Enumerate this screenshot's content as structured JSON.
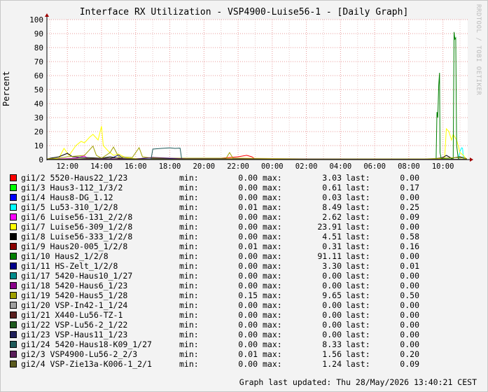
{
  "side_text": "RRDTOOL / TOBI OETIKER",
  "chart_data": {
    "type": "line",
    "title": "Interface RX Utilization - VSP4900-Luise56-1 - [Daily Graph]",
    "ylabel": "Percent",
    "ylim": [
      0,
      100
    ],
    "yticks": [
      0,
      10,
      20,
      30,
      40,
      50,
      60,
      70,
      80,
      90,
      100
    ],
    "xlim_hours": [
      10.8,
      35.45
    ],
    "xticks": [
      {
        "label": "12:00",
        "hour": 12
      },
      {
        "label": "14:00",
        "hour": 14
      },
      {
        "label": "16:00",
        "hour": 16
      },
      {
        "label": "18:00",
        "hour": 18
      },
      {
        "label": "20:00",
        "hour": 20
      },
      {
        "label": "22:00",
        "hour": 22
      },
      {
        "label": "00:00",
        "hour": 24
      },
      {
        "label": "02:00",
        "hour": 26
      },
      {
        "label": "04:00",
        "hour": 28
      },
      {
        "label": "06:00",
        "hour": 30
      },
      {
        "label": "08:00",
        "hour": 32
      },
      {
        "label": "10:00",
        "hour": 34
      },
      {
        "label": "12:00",
        "hour": 36
      }
    ],
    "grid": true,
    "series": [
      {
        "name": "gi1/2 5520-Haus22_1/23",
        "color": "#ff0000",
        "min": "0.00",
        "max": "3.03",
        "last": "0.00",
        "points": [
          [
            10.8,
            0.5
          ],
          [
            14.0,
            0.5
          ],
          [
            18.0,
            0.5
          ],
          [
            19.5,
            0.5
          ],
          [
            21.0,
            1.0
          ],
          [
            21.5,
            1.5
          ],
          [
            22.0,
            2.0
          ],
          [
            22.5,
            3.03
          ],
          [
            22.8,
            2.0
          ],
          [
            23.0,
            0.5
          ],
          [
            24.0,
            0.3
          ],
          [
            30.0,
            0.2
          ],
          [
            35.4,
            0.1
          ]
        ]
      },
      {
        "name": "gi1/3 Haus3-112_1/3/2",
        "color": "#00ff00",
        "min": "0.00",
        "max": "0.61",
        "last": "0.17",
        "points": [
          [
            10.8,
            0.2
          ],
          [
            20.0,
            0.3
          ],
          [
            22.0,
            0.6
          ],
          [
            24.0,
            0.2
          ],
          [
            35.4,
            0.2
          ]
        ]
      },
      {
        "name": "gi1/4 Haus8-DG_1.12",
        "color": "#0000ff",
        "min": "0.00",
        "max": "0.03",
        "last": "0.00",
        "points": [
          [
            10.8,
            0.0
          ],
          [
            35.4,
            0.0
          ]
        ]
      },
      {
        "name": "gi1/5 Lu53-310_1/2/8",
        "color": "#00ffff",
        "min": "0.01",
        "max": "8.49",
        "last": "0.25",
        "points": [
          [
            10.8,
            0.1
          ],
          [
            34.9,
            0.2
          ],
          [
            35.0,
            6.0
          ],
          [
            35.1,
            8.49
          ],
          [
            35.15,
            8.0
          ],
          [
            35.2,
            0.3
          ],
          [
            35.4,
            0.25
          ]
        ]
      },
      {
        "name": "gi1/6 Luise56-131_2/2/8",
        "color": "#ff00ff",
        "min": "0.00",
        "max": "2.62",
        "last": "0.09",
        "points": [
          [
            10.8,
            0.1
          ],
          [
            12.5,
            1.0
          ],
          [
            13.0,
            2.62
          ],
          [
            13.2,
            0.5
          ],
          [
            35.4,
            0.09
          ]
        ]
      },
      {
        "name": "gi1/7 Luise56-309_1/2/8",
        "color": "#ffff00",
        "min": "0.00",
        "max": "23.91",
        "last": "0.00",
        "points": [
          [
            10.8,
            0.0
          ],
          [
            11.5,
            1.0
          ],
          [
            11.8,
            8.0
          ],
          [
            12.1,
            3.0
          ],
          [
            12.5,
            10.0
          ],
          [
            12.8,
            13.0
          ],
          [
            13.0,
            12.0
          ],
          [
            13.3,
            16.0
          ],
          [
            13.5,
            18.0
          ],
          [
            13.8,
            14.0
          ],
          [
            14.0,
            23.91
          ],
          [
            14.1,
            10.0
          ],
          [
            14.4,
            6.0
          ],
          [
            14.7,
            3.0
          ],
          [
            15.0,
            4.0
          ],
          [
            15.3,
            2.0
          ],
          [
            15.6,
            1.0
          ],
          [
            16.5,
            0.5
          ],
          [
            20.0,
            0.5
          ],
          [
            21.3,
            0.8
          ],
          [
            22.0,
            1.0
          ],
          [
            26.0,
            0.5
          ],
          [
            30.0,
            0.5
          ],
          [
            33.5,
            0.5
          ],
          [
            34.1,
            1.0
          ],
          [
            34.2,
            22.0
          ],
          [
            34.35,
            20.0
          ],
          [
            34.5,
            14.0
          ],
          [
            34.6,
            18.0
          ],
          [
            34.7,
            16.0
          ],
          [
            34.8,
            14.0
          ],
          [
            35.0,
            5.0
          ],
          [
            35.2,
            3.0
          ],
          [
            35.4,
            0.0
          ]
        ]
      },
      {
        "name": "gi1/8 Luise56-333_1/2/8",
        "color": "#000000",
        "min": "0.00",
        "max": "4.51",
        "last": "0.58",
        "points": [
          [
            10.8,
            0.3
          ],
          [
            11.0,
            1.0
          ],
          [
            11.5,
            2.0
          ],
          [
            12.0,
            4.51
          ],
          [
            12.3,
            2.0
          ],
          [
            13.0,
            1.5
          ],
          [
            14.0,
            1.0
          ],
          [
            14.5,
            2.0
          ],
          [
            15.0,
            1.0
          ],
          [
            16.0,
            0.5
          ],
          [
            20.0,
            0.5
          ],
          [
            24.0,
            0.3
          ],
          [
            30.0,
            0.4
          ],
          [
            33.5,
            0.5
          ],
          [
            34.0,
            1.5
          ],
          [
            34.2,
            3.0
          ],
          [
            34.5,
            1.0
          ],
          [
            35.0,
            2.0
          ],
          [
            35.4,
            0.58
          ]
        ]
      },
      {
        "name": "gi1/9 Haus20-005_1/2/8",
        "color": "#8b0000",
        "min": "0.01",
        "max": "0.31",
        "last": "0.16",
        "points": [
          [
            10.8,
            0.1
          ],
          [
            20.0,
            0.3
          ],
          [
            24.0,
            0.1
          ],
          [
            35.4,
            0.16
          ]
        ]
      },
      {
        "name": "gi1/10 Haus2_1/2/8",
        "color": "#008000",
        "min": "0.00",
        "max": "91.11",
        "last": "0.00",
        "points": [
          [
            10.8,
            0.0
          ],
          [
            33.4,
            0.0
          ],
          [
            33.6,
            0.5
          ],
          [
            33.65,
            34.0
          ],
          [
            33.7,
            30.0
          ],
          [
            33.75,
            53.0
          ],
          [
            33.8,
            62.0
          ],
          [
            33.83,
            5.0
          ],
          [
            33.9,
            0.5
          ],
          [
            34.6,
            0.5
          ],
          [
            34.65,
            91.11
          ],
          [
            34.7,
            86.0
          ],
          [
            34.75,
            87.0
          ],
          [
            34.8,
            10.0
          ],
          [
            34.9,
            0.5
          ],
          [
            35.4,
            0.0
          ]
        ]
      },
      {
        "name": "gi1/11 HS-Zelt_1/2/8",
        "color": "#00008b",
        "min": "0.00",
        "max": "3.30",
        "last": "0.01",
        "points": [
          [
            10.8,
            0.0
          ],
          [
            14.5,
            0.5
          ],
          [
            15.0,
            3.3
          ],
          [
            15.3,
            0.5
          ],
          [
            35.4,
            0.01
          ]
        ]
      },
      {
        "name": "gi1/17 5420-Haus10_1/27",
        "color": "#008b8b",
        "min": "0.00",
        "max": "0.00",
        "last": "0.00",
        "points": [
          [
            10.8,
            0.0
          ],
          [
            35.4,
            0.0
          ]
        ]
      },
      {
        "name": "gi1/18 5420-Haus6_1/23",
        "color": "#8b008b",
        "min": "0.00",
        "max": "0.00",
        "last": "0.00",
        "points": [
          [
            10.8,
            0.0
          ],
          [
            35.4,
            0.0
          ]
        ]
      },
      {
        "name": "gi1/19 5420-Haus5_1/28",
        "color": "#a0a000",
        "min": "0.15",
        "max": "9.65",
        "last": "0.50",
        "points": [
          [
            10.8,
            0.5
          ],
          [
            11.5,
            1.0
          ],
          [
            12.0,
            2.0
          ],
          [
            13.0,
            3.0
          ],
          [
            13.5,
            9.65
          ],
          [
            13.7,
            3.0
          ],
          [
            14.0,
            1.0
          ],
          [
            14.5,
            5.0
          ],
          [
            14.7,
            9.0
          ],
          [
            15.0,
            2.0
          ],
          [
            15.8,
            1.5
          ],
          [
            16.2,
            8.5
          ],
          [
            16.4,
            2.0
          ],
          [
            17.0,
            1.0
          ],
          [
            20.0,
            1.0
          ],
          [
            21.3,
            1.0
          ],
          [
            21.5,
            5.0
          ],
          [
            21.7,
            1.0
          ],
          [
            24.0,
            0.5
          ],
          [
            28.0,
            0.5
          ],
          [
            30.0,
            0.5
          ],
          [
            33.0,
            0.5
          ],
          [
            34.0,
            1.0
          ],
          [
            35.0,
            1.5
          ],
          [
            35.4,
            0.5
          ]
        ]
      },
      {
        "name": "gi1/20 VSP-In42-1_1/24",
        "color": "#a0a0a0",
        "min": "0.00",
        "max": "0.00",
        "last": "0.00",
        "points": [
          [
            10.8,
            0.0
          ],
          [
            35.4,
            0.0
          ]
        ]
      },
      {
        "name": "gi1/21 X440-Lu56-TZ-1",
        "color": "#5a1e1e",
        "min": "0.00",
        "max": "0.00",
        "last": "0.00",
        "points": [
          [
            10.8,
            0.0
          ],
          [
            35.4,
            0.0
          ]
        ]
      },
      {
        "name": "gi1/22 VSP-Lu56-2_1/22",
        "color": "#1e5a1e",
        "min": "0.00",
        "max": "0.00",
        "last": "0.00",
        "points": [
          [
            10.8,
            0.0
          ],
          [
            35.4,
            0.0
          ]
        ]
      },
      {
        "name": "gi1/23 VSP-Haus11_1/23",
        "color": "#1e1e5a",
        "min": "0.00",
        "max": "0.00",
        "last": "0.00",
        "points": [
          [
            10.8,
            0.0
          ],
          [
            35.4,
            0.0
          ]
        ]
      },
      {
        "name": "gi1/24 5420-Haus18-K09_1/27",
        "color": "#1e5a5a",
        "min": "0.00",
        "max": "8.33",
        "last": "0.00",
        "points": [
          [
            10.8,
            0.0
          ],
          [
            16.9,
            0.0
          ],
          [
            17.0,
            7.5
          ],
          [
            17.5,
            8.0
          ],
          [
            18.0,
            8.33
          ],
          [
            18.3,
            8.0
          ],
          [
            18.6,
            8.2
          ],
          [
            18.7,
            0.0
          ],
          [
            35.4,
            0.0
          ]
        ]
      },
      {
        "name": "gi2/3 VSP4900-Lu56-2_2/3",
        "color": "#5a1e5a",
        "min": "0.01",
        "max": "1.56",
        "last": "0.20",
        "points": [
          [
            10.8,
            0.2
          ],
          [
            16.0,
            0.5
          ],
          [
            17.0,
            1.56
          ],
          [
            19.0,
            0.5
          ],
          [
            35.4,
            0.2
          ]
        ]
      },
      {
        "name": "gi2/4 VSP-Zie13a-K006-1_2/1",
        "color": "#5a5a1e",
        "min": "0.00",
        "max": "1.24",
        "last": "0.09",
        "points": [
          [
            10.8,
            0.1
          ],
          [
            15.0,
            1.24
          ],
          [
            16.0,
            0.3
          ],
          [
            35.4,
            0.09
          ]
        ]
      }
    ]
  },
  "legend_labels": {
    "min": "min:",
    "max": "max:",
    "last": "last:"
  },
  "footer": "Graph last updated: Thu 28/May/2026 13:40:21 CEST"
}
